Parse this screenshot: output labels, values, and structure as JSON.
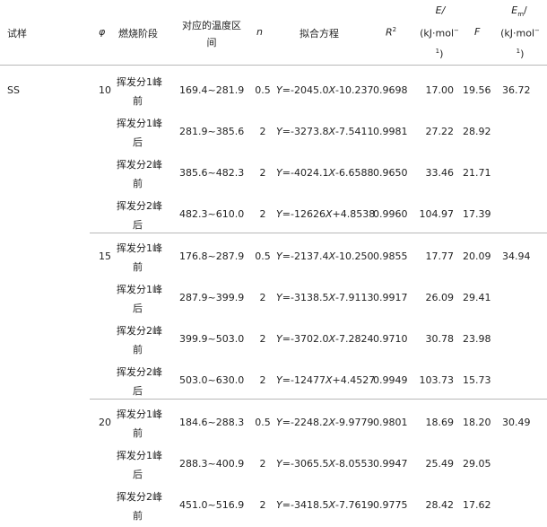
{
  "headers": {
    "sample": "试样",
    "phi": "φ",
    "stage": "燃烧阶段",
    "temp_range_l1": "对应的温度区",
    "temp_range_l2": "间",
    "n": "n",
    "equation": "拟合方程",
    "r2_base": "R",
    "r2_sup": "2",
    "e_l1": "E/",
    "e_l2": "(kJ·mol",
    "e_l2_sup": "−",
    "e_l3": "1",
    "e_l3_end": ")",
    "f": "F",
    "em_l1_base": "E",
    "em_l1_sub": "m",
    "em_l1_end": "/",
    "em_l2": "(kJ·mol",
    "em_l2_sup": "−",
    "em_l3": "1",
    "em_l3_end": ")"
  },
  "sample_name": "SS",
  "groups": [
    {
      "phi": "10",
      "em": "36.72",
      "rows": [
        {
          "stage1": "挥发分1峰",
          "stage2": "前",
          "temp": "169.4~281.9",
          "n": "0.5",
          "eq": "Y=-2045.0X-10.237",
          "r2": "0.9698",
          "e": "17.00",
          "f": "19.56"
        },
        {
          "stage1": "挥发分1峰",
          "stage2": "后",
          "temp": "281.9~385.6",
          "n": "2",
          "eq": "Y=-3273.8X-7.5411",
          "r2": "0.9981",
          "e": "27.22",
          "f": "28.92"
        },
        {
          "stage1": "挥发分2峰",
          "stage2": "前",
          "temp": "385.6~482.3",
          "n": "2",
          "eq": "Y=-4024.1X-6.6588",
          "r2": "0.9650",
          "e": "33.46",
          "f": "21.71"
        },
        {
          "stage1": "挥发分2峰",
          "stage2": "后",
          "temp": "482.3~610.0",
          "n": "2",
          "eq": "Y=-12626X+4.8538",
          "r2": "0.9960",
          "e": "104.97",
          "f": "17.39"
        }
      ]
    },
    {
      "phi": "15",
      "em": "34.94",
      "rows": [
        {
          "stage1": "挥发分1峰",
          "stage2": "前",
          "temp": "176.8~287.9",
          "n": "0.5",
          "eq": "Y=-2137.4X-10.250",
          "r2": "0.9855",
          "e": "17.77",
          "f": "20.09"
        },
        {
          "stage1": "挥发分1峰",
          "stage2": "后",
          "temp": "287.9~399.9",
          "n": "2",
          "eq": "Y=-3138.5X-7.9113",
          "r2": "0.9917",
          "e": "26.09",
          "f": "29.41"
        },
        {
          "stage1": "挥发分2峰",
          "stage2": "前",
          "temp": "399.9~503.0",
          "n": "2",
          "eq": "Y=-3702.0X-7.2824",
          "r2": "0.9710",
          "e": "30.78",
          "f": "23.98"
        },
        {
          "stage1": "挥发分2峰",
          "stage2": "后",
          "temp": "503.0~630.0",
          "n": "2",
          "eq": "Y=-12477X+4.4527",
          "r2": "0.9949",
          "e": "103.73",
          "f": "15.73"
        }
      ]
    },
    {
      "phi": "20",
      "em": "30.49",
      "rows": [
        {
          "stage1": "挥发分1峰",
          "stage2": "前",
          "temp": "184.6~288.3",
          "n": "0.5",
          "eq": "Y=-2248.2X-9.9779",
          "r2": "0.9801",
          "e": "18.69",
          "f": "18.20"
        },
        {
          "stage1": "挥发分1峰",
          "stage2": "后",
          "temp": "288.3~400.9",
          "n": "2",
          "eq": "Y=-3065.5X-8.0553",
          "r2": "0.9947",
          "e": "25.49",
          "f": "29.05"
        },
        {
          "stage1": "挥发分2峰",
          "stage2": "前",
          "temp": "451.0~516.9",
          "n": "2",
          "eq": "Y=-3418.5X-7.7619",
          "r2": "0.9775",
          "e": "28.42",
          "f": "17.62"
        }
      ]
    }
  ]
}
